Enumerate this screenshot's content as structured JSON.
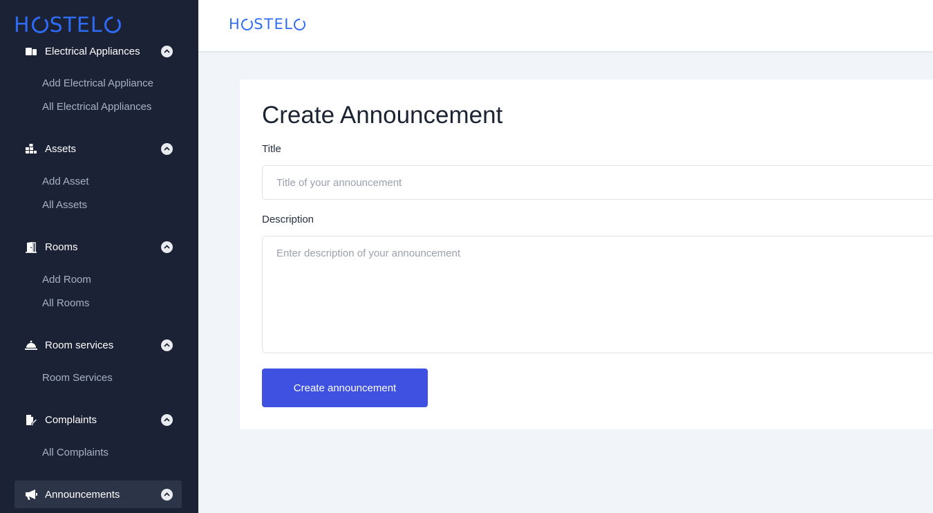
{
  "brand": {
    "logo_prefix": "H",
    "logo_suffix": "STEL",
    "logo_full": "HOSTELO",
    "color": "#2f6cf6"
  },
  "sidebar": {
    "partial_group": {
      "label": "Electrical Appliances",
      "icon": "appliance-icon"
    },
    "partial_items": [
      "Add Electrical Appliance",
      "All Electrical Appliances"
    ],
    "groups": [
      {
        "label": "Assets",
        "icon": "assets-icon",
        "items": [
          "Add Asset",
          "All Assets"
        ]
      },
      {
        "label": "Rooms",
        "icon": "door-icon",
        "items": [
          "Add Room",
          "All Rooms"
        ]
      },
      {
        "label": "Room services",
        "icon": "service-bell-icon",
        "items": [
          "Room Services"
        ]
      },
      {
        "label": "Complaints",
        "icon": "complaint-icon",
        "items": [
          "All Complaints"
        ]
      },
      {
        "label": "Announcements",
        "icon": "megaphone-icon",
        "items": [],
        "active": true
      }
    ]
  },
  "form": {
    "title": "Create Announcement",
    "title_label": "Title",
    "title_placeholder": "Title of your announcement",
    "title_value": "",
    "description_label": "Description",
    "description_placeholder": "Enter description of your announcement",
    "description_value": "",
    "submit_label": "Create announcement",
    "accent": "#3f51e0"
  }
}
